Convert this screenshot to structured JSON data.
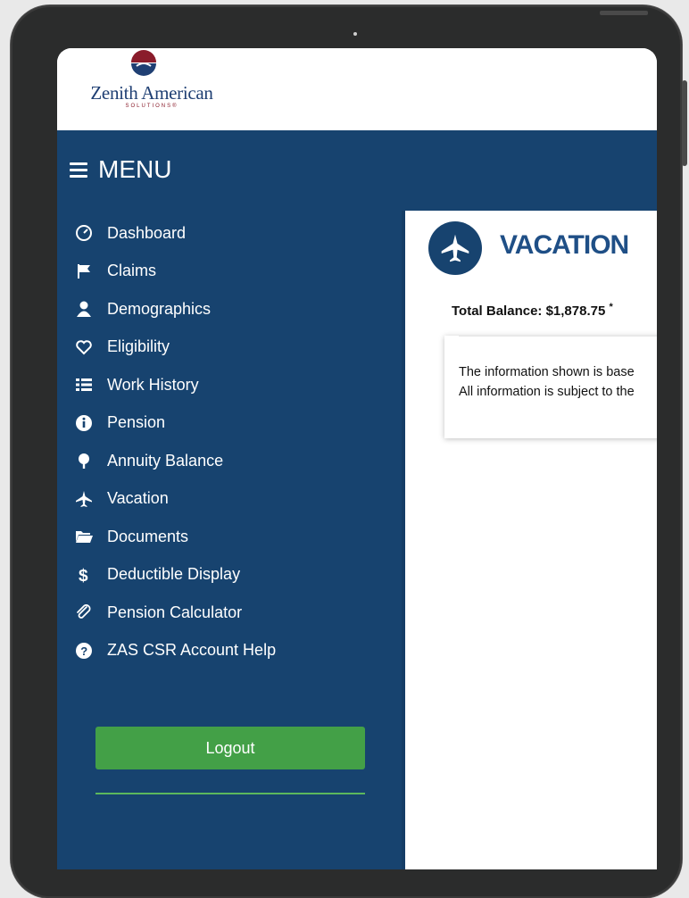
{
  "brand": {
    "name": "Zenith American",
    "sub": "SOLUTIONS®",
    "colors": {
      "navy": "#17436f",
      "maroon": "#8a1c2b",
      "green": "#43a047"
    }
  },
  "menu": {
    "title": "MENU",
    "items": [
      {
        "label": "Dashboard",
        "icon": "dashboard-icon"
      },
      {
        "label": "Claims",
        "icon": "flag-icon"
      },
      {
        "label": "Demographics",
        "icon": "user-icon"
      },
      {
        "label": "Eligibility",
        "icon": "heart-icon"
      },
      {
        "label": "Work History",
        "icon": "list-icon"
      },
      {
        "label": "Pension",
        "icon": "info-icon"
      },
      {
        "label": "Annuity Balance",
        "icon": "tree-icon"
      },
      {
        "label": "Vacation",
        "icon": "plane-icon"
      },
      {
        "label": "Documents",
        "icon": "folder-icon"
      },
      {
        "label": "Deductible Display",
        "icon": "dollar-icon"
      },
      {
        "label": "Pension Calculator",
        "icon": "paperclip-icon"
      },
      {
        "label": "ZAS CSR Account Help",
        "icon": "question-icon"
      }
    ],
    "logout_label": "Logout"
  },
  "content": {
    "title": "VACATION",
    "balance": "Total Balance: $1,878.75",
    "balance_mark": "*",
    "info_line1": "The information shown is base",
    "info_line2": "All information is subject to the"
  }
}
